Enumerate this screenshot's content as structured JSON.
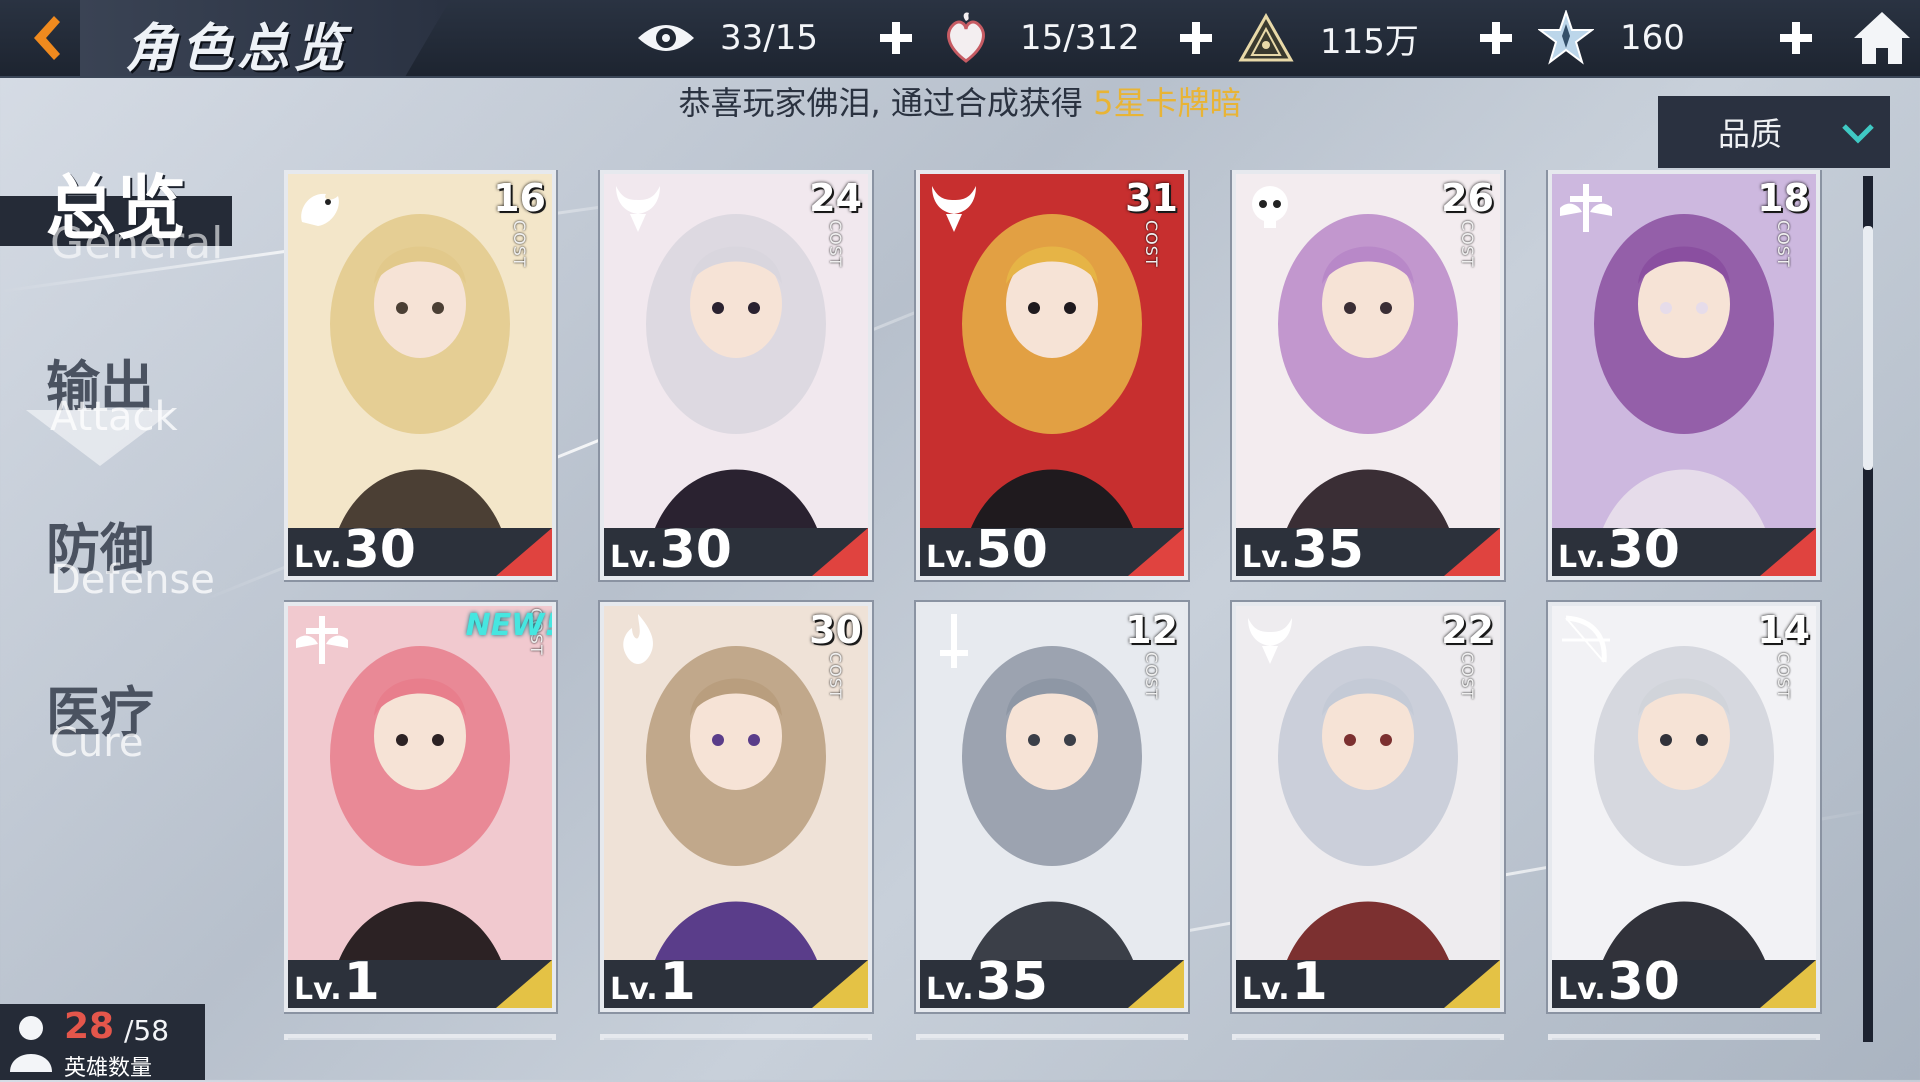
{
  "title": "角色总览",
  "resources": [
    {
      "icon": "eye-icon",
      "value": "33/15"
    },
    {
      "icon": "heart-flame-icon",
      "value": "15/312"
    },
    {
      "icon": "pyramid-icon",
      "value": "115万"
    },
    {
      "icon": "star-crystal-icon",
      "value": "160"
    }
  ],
  "notice": {
    "prefix": "恭喜玩家佛泪, 通过合成获得 ",
    "highlight": "5星卡牌暗"
  },
  "filter": {
    "label": "品质"
  },
  "nav": [
    {
      "zh": "总览",
      "en": "General",
      "active": true
    },
    {
      "zh": "输出",
      "en": "Attack",
      "active": false
    },
    {
      "zh": "防御",
      "en": "Defense",
      "active": false
    },
    {
      "zh": "医疗",
      "en": "Cure",
      "active": false
    }
  ],
  "cost_label": "COST",
  "lv_label": "Lv.",
  "new_label": "NEW!",
  "cards": [
    {
      "cost": "16",
      "level": "30",
      "class_icon": "dragon-icon",
      "corner": "red",
      "palette": [
        "#f3e6c9",
        "#e2c98b",
        "#4b3f34"
      ]
    },
    {
      "cost": "24",
      "level": "30",
      "class_icon": "demon-horn-icon",
      "corner": "red",
      "palette": [
        "#f1e8ee",
        "#d9d6de",
        "#2a2230"
      ]
    },
    {
      "cost": "31",
      "level": "50",
      "class_icon": "demon-horn-icon",
      "corner": "red",
      "palette": [
        "#c72f2f",
        "#e6b446",
        "#1f1a1e"
      ]
    },
    {
      "cost": "26",
      "level": "35",
      "class_icon": "skull-icon",
      "corner": "red",
      "palette": [
        "#f3ecef",
        "#b888c8",
        "#3a2e35"
      ]
    },
    {
      "cost": "18",
      "level": "30",
      "class_icon": "cross-wing-icon",
      "corner": "red",
      "palette": [
        "#cdb8df",
        "#8a4fa0",
        "#e6dcea"
      ]
    },
    {
      "cost": "",
      "level": "1",
      "class_icon": "cross-wing-icon",
      "corner": "gold",
      "is_new": true,
      "palette": [
        "#f1c9cf",
        "#e87e8c",
        "#2c2224"
      ]
    },
    {
      "cost": "30",
      "level": "1",
      "class_icon": "flame-icon",
      "corner": "gold",
      "palette": [
        "#efe2d7",
        "#b99e7e",
        "#5a3d8a"
      ]
    },
    {
      "cost": "12",
      "level": "35",
      "class_icon": "sword-icon",
      "corner": "gold",
      "palette": [
        "#e7eaef",
        "#8e97a5",
        "#3b3f48"
      ]
    },
    {
      "cost": "22",
      "level": "1",
      "class_icon": "demon-horn-icon",
      "corner": "gold",
      "palette": [
        "#eeecef",
        "#c4cad6",
        "#7c3030"
      ]
    },
    {
      "cost": "14",
      "level": "30",
      "class_icon": "bow-icon",
      "corner": "gold",
      "palette": [
        "#f2f2f5",
        "#d1d4da",
        "#31323a"
      ]
    }
  ],
  "hero_count": {
    "current": "28",
    "total": "/58",
    "label": "英雄数量"
  }
}
